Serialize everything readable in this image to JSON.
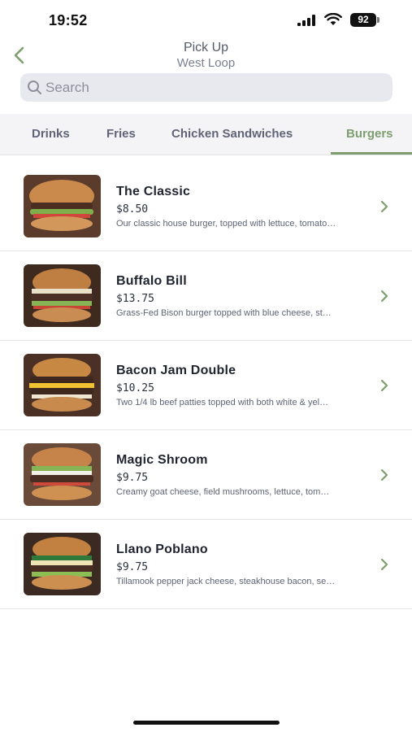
{
  "status_bar": {
    "time": "19:52",
    "battery": "92"
  },
  "header": {
    "title": "Pick Up",
    "subtitle": "West Loop"
  },
  "search": {
    "placeholder": "Search"
  },
  "tabs": [
    {
      "label": "Drinks"
    },
    {
      "label": "Fries"
    },
    {
      "label": "Chicken Sandwiches"
    },
    {
      "label": "Burgers",
      "active": true
    }
  ],
  "items": [
    {
      "name": "The Classic",
      "price": "$8.50",
      "description": "Our classic house burger, topped with lettuce, tomato…"
    },
    {
      "name": "Buffalo Bill",
      "price": "$13.75",
      "description": "Grass-Fed Bison burger topped with blue cheese, st…"
    },
    {
      "name": "Bacon Jam Double",
      "price": "$10.25",
      "description": "Two 1/4 lb beef patties topped with both white & yel…"
    },
    {
      "name": "Magic Shroom",
      "price": "$9.75",
      "description": "Creamy goat cheese, field mushrooms, lettuce, tom…"
    },
    {
      "name": "Llano Poblano",
      "price": "$9.75",
      "description": "Tillamook pepper jack cheese, steakhouse bacon, se…"
    }
  ],
  "colors": {
    "accent": "#7e9e6f",
    "tab_bar_bg": "#f4f4f6",
    "search_bg": "#e8e9ee"
  }
}
